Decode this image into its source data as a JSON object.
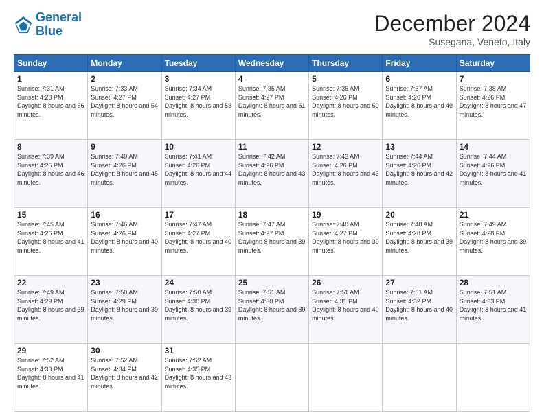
{
  "header": {
    "logo_line1": "General",
    "logo_line2": "Blue",
    "month": "December 2024",
    "location": "Susegana, Veneto, Italy"
  },
  "days_of_week": [
    "Sunday",
    "Monday",
    "Tuesday",
    "Wednesday",
    "Thursday",
    "Friday",
    "Saturday"
  ],
  "weeks": [
    [
      {
        "day": "1",
        "sunrise": "Sunrise: 7:31 AM",
        "sunset": "Sunset: 4:28 PM",
        "daylight": "Daylight: 8 hours and 56 minutes."
      },
      {
        "day": "2",
        "sunrise": "Sunrise: 7:33 AM",
        "sunset": "Sunset: 4:27 PM",
        "daylight": "Daylight: 8 hours and 54 minutes."
      },
      {
        "day": "3",
        "sunrise": "Sunrise: 7:34 AM",
        "sunset": "Sunset: 4:27 PM",
        "daylight": "Daylight: 8 hours and 53 minutes."
      },
      {
        "day": "4",
        "sunrise": "Sunrise: 7:35 AM",
        "sunset": "Sunset: 4:27 PM",
        "daylight": "Daylight: 8 hours and 51 minutes."
      },
      {
        "day": "5",
        "sunrise": "Sunrise: 7:36 AM",
        "sunset": "Sunset: 4:26 PM",
        "daylight": "Daylight: 8 hours and 50 minutes."
      },
      {
        "day": "6",
        "sunrise": "Sunrise: 7:37 AM",
        "sunset": "Sunset: 4:26 PM",
        "daylight": "Daylight: 8 hours and 49 minutes."
      },
      {
        "day": "7",
        "sunrise": "Sunrise: 7:38 AM",
        "sunset": "Sunset: 4:26 PM",
        "daylight": "Daylight: 8 hours and 47 minutes."
      }
    ],
    [
      {
        "day": "8",
        "sunrise": "Sunrise: 7:39 AM",
        "sunset": "Sunset: 4:26 PM",
        "daylight": "Daylight: 8 hours and 46 minutes."
      },
      {
        "day": "9",
        "sunrise": "Sunrise: 7:40 AM",
        "sunset": "Sunset: 4:26 PM",
        "daylight": "Daylight: 8 hours and 45 minutes."
      },
      {
        "day": "10",
        "sunrise": "Sunrise: 7:41 AM",
        "sunset": "Sunset: 4:26 PM",
        "daylight": "Daylight: 8 hours and 44 minutes."
      },
      {
        "day": "11",
        "sunrise": "Sunrise: 7:42 AM",
        "sunset": "Sunset: 4:26 PM",
        "daylight": "Daylight: 8 hours and 43 minutes."
      },
      {
        "day": "12",
        "sunrise": "Sunrise: 7:43 AM",
        "sunset": "Sunset: 4:26 PM",
        "daylight": "Daylight: 8 hours and 43 minutes."
      },
      {
        "day": "13",
        "sunrise": "Sunrise: 7:44 AM",
        "sunset": "Sunset: 4:26 PM",
        "daylight": "Daylight: 8 hours and 42 minutes."
      },
      {
        "day": "14",
        "sunrise": "Sunrise: 7:44 AM",
        "sunset": "Sunset: 4:26 PM",
        "daylight": "Daylight: 8 hours and 41 minutes."
      }
    ],
    [
      {
        "day": "15",
        "sunrise": "Sunrise: 7:45 AM",
        "sunset": "Sunset: 4:26 PM",
        "daylight": "Daylight: 8 hours and 41 minutes."
      },
      {
        "day": "16",
        "sunrise": "Sunrise: 7:46 AM",
        "sunset": "Sunset: 4:26 PM",
        "daylight": "Daylight: 8 hours and 40 minutes."
      },
      {
        "day": "17",
        "sunrise": "Sunrise: 7:47 AM",
        "sunset": "Sunset: 4:27 PM",
        "daylight": "Daylight: 8 hours and 40 minutes."
      },
      {
        "day": "18",
        "sunrise": "Sunrise: 7:47 AM",
        "sunset": "Sunset: 4:27 PM",
        "daylight": "Daylight: 8 hours and 39 minutes."
      },
      {
        "day": "19",
        "sunrise": "Sunrise: 7:48 AM",
        "sunset": "Sunset: 4:27 PM",
        "daylight": "Daylight: 8 hours and 39 minutes."
      },
      {
        "day": "20",
        "sunrise": "Sunrise: 7:48 AM",
        "sunset": "Sunset: 4:28 PM",
        "daylight": "Daylight: 8 hours and 39 minutes."
      },
      {
        "day": "21",
        "sunrise": "Sunrise: 7:49 AM",
        "sunset": "Sunset: 4:28 PM",
        "daylight": "Daylight: 8 hours and 39 minutes."
      }
    ],
    [
      {
        "day": "22",
        "sunrise": "Sunrise: 7:49 AM",
        "sunset": "Sunset: 4:29 PM",
        "daylight": "Daylight: 8 hours and 39 minutes."
      },
      {
        "day": "23",
        "sunrise": "Sunrise: 7:50 AM",
        "sunset": "Sunset: 4:29 PM",
        "daylight": "Daylight: 8 hours and 39 minutes."
      },
      {
        "day": "24",
        "sunrise": "Sunrise: 7:50 AM",
        "sunset": "Sunset: 4:30 PM",
        "daylight": "Daylight: 8 hours and 39 minutes."
      },
      {
        "day": "25",
        "sunrise": "Sunrise: 7:51 AM",
        "sunset": "Sunset: 4:30 PM",
        "daylight": "Daylight: 8 hours and 39 minutes."
      },
      {
        "day": "26",
        "sunrise": "Sunrise: 7:51 AM",
        "sunset": "Sunset: 4:31 PM",
        "daylight": "Daylight: 8 hours and 40 minutes."
      },
      {
        "day": "27",
        "sunrise": "Sunrise: 7:51 AM",
        "sunset": "Sunset: 4:32 PM",
        "daylight": "Daylight: 8 hours and 40 minutes."
      },
      {
        "day": "28",
        "sunrise": "Sunrise: 7:51 AM",
        "sunset": "Sunset: 4:33 PM",
        "daylight": "Daylight: 8 hours and 41 minutes."
      }
    ],
    [
      {
        "day": "29",
        "sunrise": "Sunrise: 7:52 AM",
        "sunset": "Sunset: 4:33 PM",
        "daylight": "Daylight: 8 hours and 41 minutes."
      },
      {
        "day": "30",
        "sunrise": "Sunrise: 7:52 AM",
        "sunset": "Sunset: 4:34 PM",
        "daylight": "Daylight: 8 hours and 42 minutes."
      },
      {
        "day": "31",
        "sunrise": "Sunrise: 7:52 AM",
        "sunset": "Sunset: 4:35 PM",
        "daylight": "Daylight: 8 hours and 43 minutes."
      },
      null,
      null,
      null,
      null
    ]
  ]
}
